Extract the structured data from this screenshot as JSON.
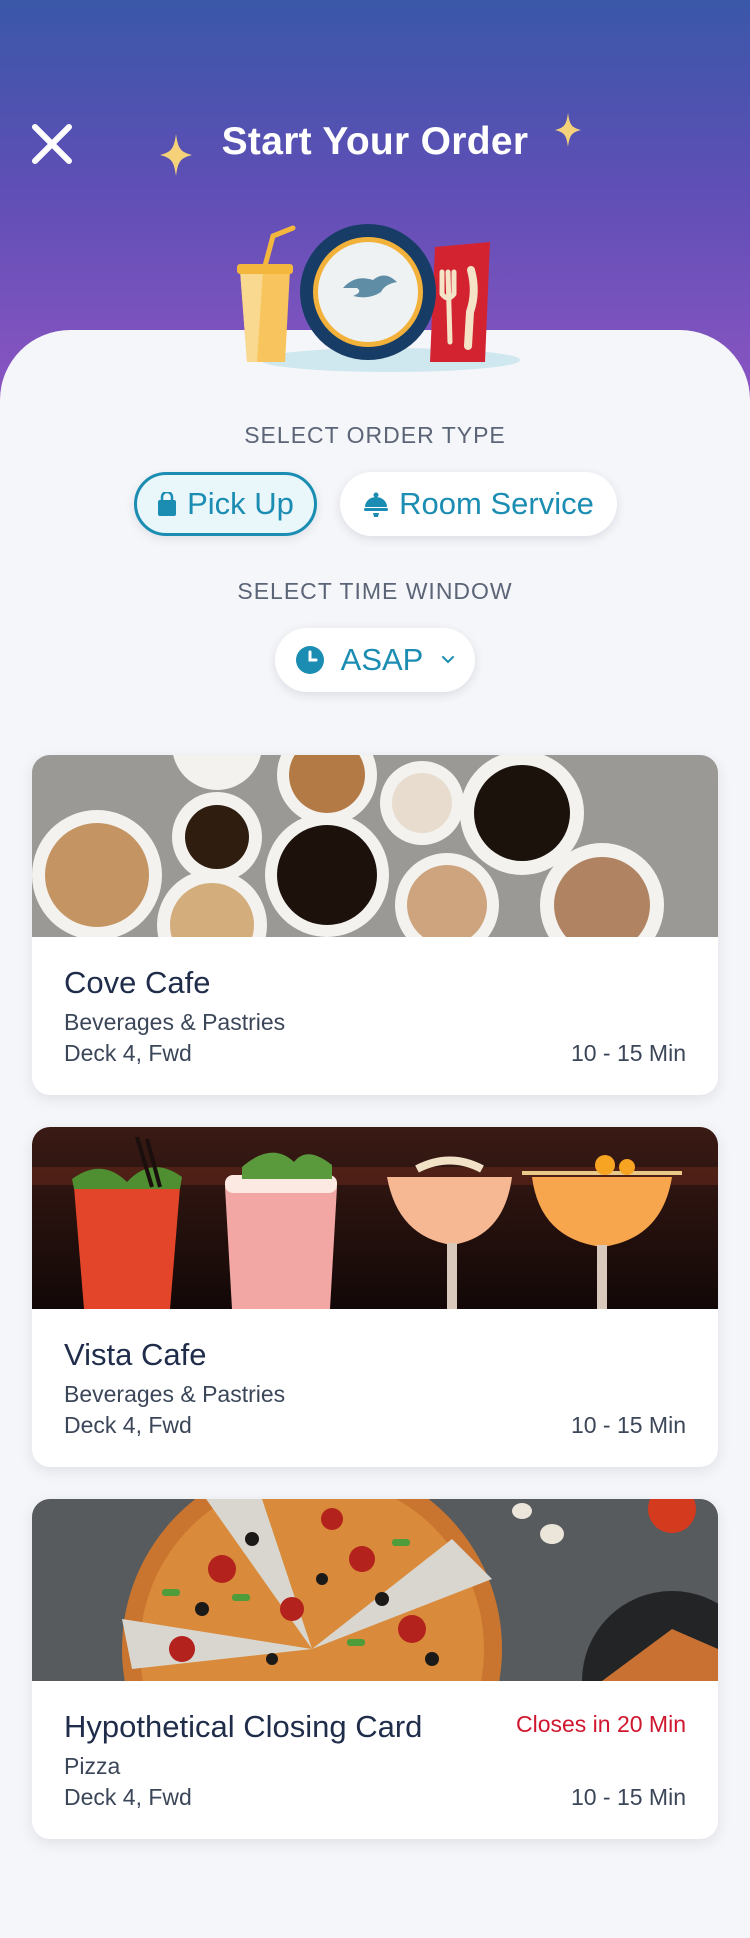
{
  "header": {
    "title": "Start Your Order"
  },
  "order_type": {
    "label": "SELECT ORDER TYPE",
    "options": [
      {
        "label": "Pick Up",
        "icon": "shopping-bag-icon",
        "selected": true
      },
      {
        "label": "Room Service",
        "icon": "cloche-icon",
        "selected": false
      }
    ]
  },
  "time_window": {
    "label": "SELECT TIME WINDOW",
    "value": "ASAP",
    "icon": "clock-icon"
  },
  "venues": [
    {
      "name": "Cove Cafe",
      "category": "Beverages & Pastries",
      "location": "Deck 4, Fwd",
      "wait": "10 - 15 Min",
      "image": "coffee-cups-photo"
    },
    {
      "name": "Vista Cafe",
      "category": "Beverages & Pastries",
      "location": "Deck 4, Fwd",
      "wait": "10 - 15 Min",
      "image": "cocktails-photo"
    },
    {
      "name": "Hypothetical Closing Card",
      "category": "Pizza",
      "location": "Deck 4, Fwd",
      "wait": "10 - 15 Min",
      "status": "Closes in 20 Min",
      "image": "pizza-photo"
    }
  ],
  "colors": {
    "accent": "#1b8db2",
    "alert": "#d0162e",
    "header_top": "#3a57a8",
    "header_bottom": "#8f55c3",
    "text": "#1f2d4a"
  }
}
